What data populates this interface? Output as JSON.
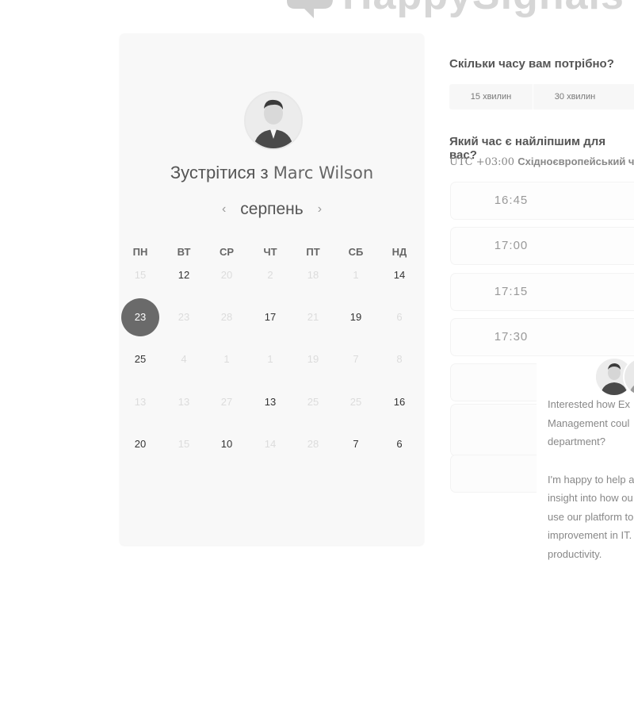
{
  "logo": {
    "text": "HappySignals"
  },
  "card": {
    "title_prefix": "Зустрітися з",
    "host_name": "Marc Wilson",
    "month": "серпень",
    "prev_icon": "chevron-left-icon",
    "next_icon": "chevron-right-icon",
    "weekdays": [
      "ПН",
      "ВТ",
      "СР",
      "ЧТ",
      "ПТ",
      "СБ",
      "НД"
    ],
    "weeks": [
      [
        {
          "d": "15",
          "s": "muted"
        },
        {
          "d": "12",
          "s": "available"
        },
        {
          "d": "20",
          "s": "muted"
        },
        {
          "d": "2",
          "s": "muted"
        },
        {
          "d": "18",
          "s": "muted"
        },
        {
          "d": "1",
          "s": "muted"
        },
        {
          "d": "14",
          "s": "available"
        }
      ],
      [
        {
          "d": "23",
          "s": "selected"
        },
        {
          "d": "23",
          "s": "muted"
        },
        {
          "d": "28",
          "s": "muted"
        },
        {
          "d": "17",
          "s": "available"
        },
        {
          "d": "21",
          "s": "muted"
        },
        {
          "d": "19",
          "s": "available"
        },
        {
          "d": "6",
          "s": "muted"
        }
      ],
      [
        {
          "d": "25",
          "s": "available"
        },
        {
          "d": "4",
          "s": "muted"
        },
        {
          "d": "1",
          "s": "muted"
        },
        {
          "d": "1",
          "s": "muted"
        },
        {
          "d": "19",
          "s": "muted"
        },
        {
          "d": "7",
          "s": "muted"
        },
        {
          "d": "8",
          "s": "muted"
        }
      ],
      [
        {
          "d": "13",
          "s": "muted"
        },
        {
          "d": "13",
          "s": "muted"
        },
        {
          "d": "27",
          "s": "muted"
        },
        {
          "d": "13",
          "s": "available"
        },
        {
          "d": "25",
          "s": "muted"
        },
        {
          "d": "25",
          "s": "muted"
        },
        {
          "d": "16",
          "s": "available"
        }
      ],
      [
        {
          "d": "20",
          "s": "available"
        },
        {
          "d": "15",
          "s": "muted"
        },
        {
          "d": "10",
          "s": "available"
        },
        {
          "d": "14",
          "s": "muted"
        },
        {
          "d": "28",
          "s": "muted"
        },
        {
          "d": "7",
          "s": "available"
        },
        {
          "d": "6",
          "s": "available"
        }
      ]
    ]
  },
  "duration": {
    "question": "Скільки часу вам потрібно?",
    "options": [
      "15 хвилин",
      "30 хвилин"
    ]
  },
  "time": {
    "question": "Який час є найліпшим для вас?",
    "timezone_offset": "UTC +03:00",
    "timezone_name": "Східноєвропейський час",
    "slots": [
      "16:45",
      "17:00",
      "17:15",
      "17:30",
      "",
      "",
      ""
    ]
  },
  "chat": {
    "line1": "Interested how Ex",
    "line2": "Management coul",
    "line3": "department?",
    "line4": "I'm happy to help a",
    "line5": "insight into how ou",
    "line6": "use our platform to",
    "line7": "improvement in IT.",
    "line8": "productivity."
  },
  "colors": {
    "selected_day": "#6a6a6a",
    "card_bg": "#f8f8f8"
  }
}
